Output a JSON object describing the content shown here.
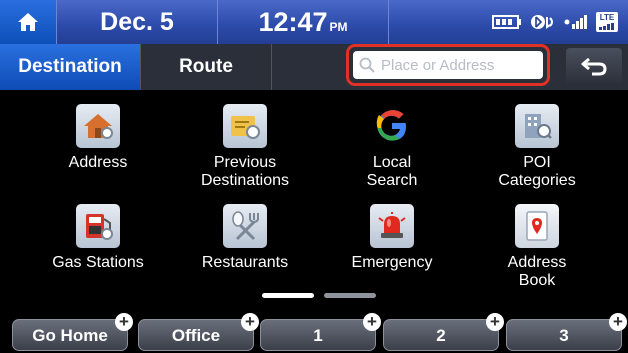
{
  "status": {
    "date": "Dec.  5",
    "time": "12:47",
    "ampm": "PM",
    "lte": "LTE"
  },
  "tabs": {
    "destination": "Destination",
    "route": "Route"
  },
  "search": {
    "placeholder": "Place or Address"
  },
  "grid": [
    {
      "label": "Address",
      "icon": "house-icon"
    },
    {
      "label": "Previous\nDestinations",
      "icon": "folder-clock-icon"
    },
    {
      "label": "Local\nSearch",
      "icon": "google-icon"
    },
    {
      "label": "POI\nCategories",
      "icon": "building-search-icon"
    },
    {
      "label": "Gas Stations",
      "icon": "gas-pump-icon"
    },
    {
      "label": "Restaurants",
      "icon": "spoon-fork-icon"
    },
    {
      "label": "Emergency",
      "icon": "siren-icon"
    },
    {
      "label": "Address\nBook",
      "icon": "address-book-icon"
    }
  ],
  "favorites": [
    "Go Home",
    "Office",
    "1",
    "2",
    "3"
  ],
  "pager": {
    "current_page": 1,
    "total_pages": 2
  },
  "colors": {
    "accent": "#1565d8",
    "highlight": "#e03127"
  }
}
